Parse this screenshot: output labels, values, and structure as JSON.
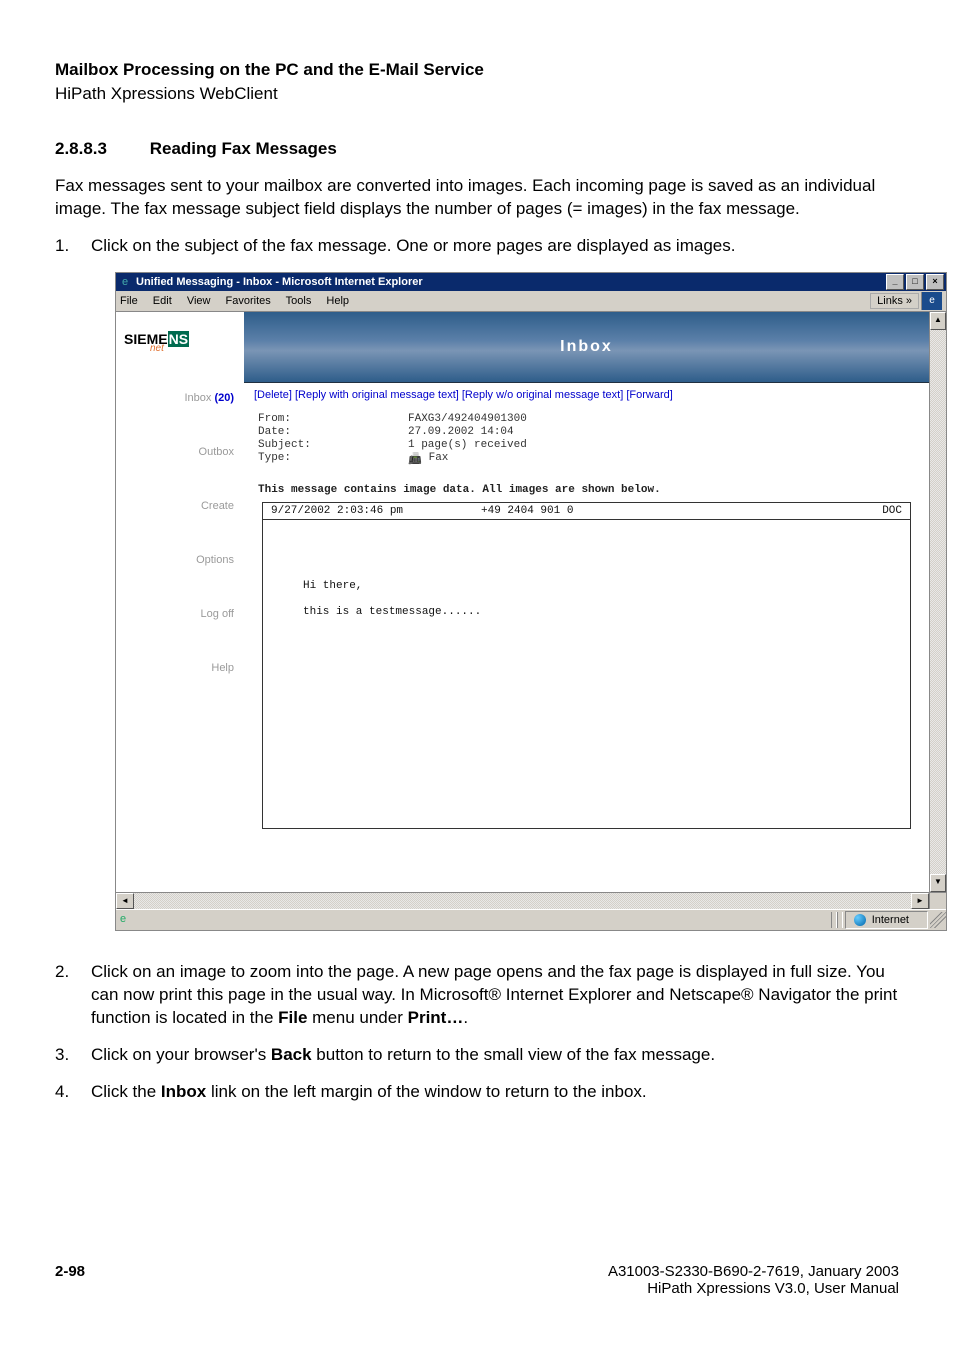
{
  "doc": {
    "chapter_title": "Mailbox Processing on the PC and the E-Mail Service",
    "chapter_sub": "HiPath Xpressions WebClient",
    "section_num": "2.8.8.3",
    "section_title": "Reading Fax Messages",
    "intro": "Fax messages sent to your mailbox are converted into images. Each incoming page is saved as an individual image. The fax message subject field displays the number of pages (= images) in the fax message.",
    "steps": {
      "s1_idx": "1.",
      "s1": "Click on the subject of the fax message. One or more pages are displayed as images.",
      "s2_idx": "2.",
      "s2_a": "Click on an image to zoom into the page. A new page opens and the fax page is displayed in full size. You can now print this page in the usual way. In Microsoft® Internet Explorer and Netscape® Navigator the print function is located in the ",
      "s2_b": "File",
      "s2_c": " menu under ",
      "s2_d": "Print…",
      "s2_e": ".",
      "s3_idx": "3.",
      "s3_a": "Click on your browser's ",
      "s3_b": "Back",
      "s3_c": " button to return to the small view of the fax message.",
      "s4_idx": "4.",
      "s4_a": "Click the ",
      "s4_b": "Inbox",
      "s4_c": " link on the left margin of the window to return to the inbox."
    },
    "footer_id": "A31003-S2330-B690-2-7619, January 2003",
    "footer_manual": "HiPath Xpressions V3.0, User Manual",
    "page_num": "2-98"
  },
  "win": {
    "title": "Unified Messaging - Inbox - Microsoft Internet Explorer",
    "btn_min": "_",
    "btn_max": "□",
    "btn_close": "×"
  },
  "menu": {
    "file": "File",
    "edit": "Edit",
    "view": "View",
    "favorites": "Favorites",
    "tools": "Tools",
    "help": "Help",
    "links": "Links »"
  },
  "sidebar": {
    "logo_a": "SIEME",
    "logo_b": "NS",
    "logo_sub": "net",
    "items": {
      "inbox_label": "Inbox",
      "inbox_count": "(20)",
      "outbox": "Outbox",
      "create": "Create",
      "options": "Options",
      "logoff": "Log off",
      "help": "Help"
    }
  },
  "banner": {
    "title": "Inbox"
  },
  "actions": {
    "full": "[Delete] [Reply with original message text] [Reply w/o original message text] [Forward]"
  },
  "meta": {
    "from_l": "From:",
    "from_v": "FAXG3/492404901300",
    "date_l": "Date:",
    "date_v": "27.09.2002 14:04",
    "subj_l": "Subject:",
    "subj_v": "1 page(s) received",
    "type_l": "Type:",
    "type_v": "Fax"
  },
  "note": "This message contains image data. All images are shown below.",
  "fax": {
    "h_date": "9/27/2002 2:03:46 pm",
    "h_num": "+49 2404 901 0",
    "h_doc": "DOC",
    "line1": "Hi there,",
    "line2": "this is a testmessage......"
  },
  "status": {
    "zone": "Internet"
  },
  "scroll": {
    "up": "▲",
    "down": "▼",
    "left": "◄",
    "right": "►"
  }
}
